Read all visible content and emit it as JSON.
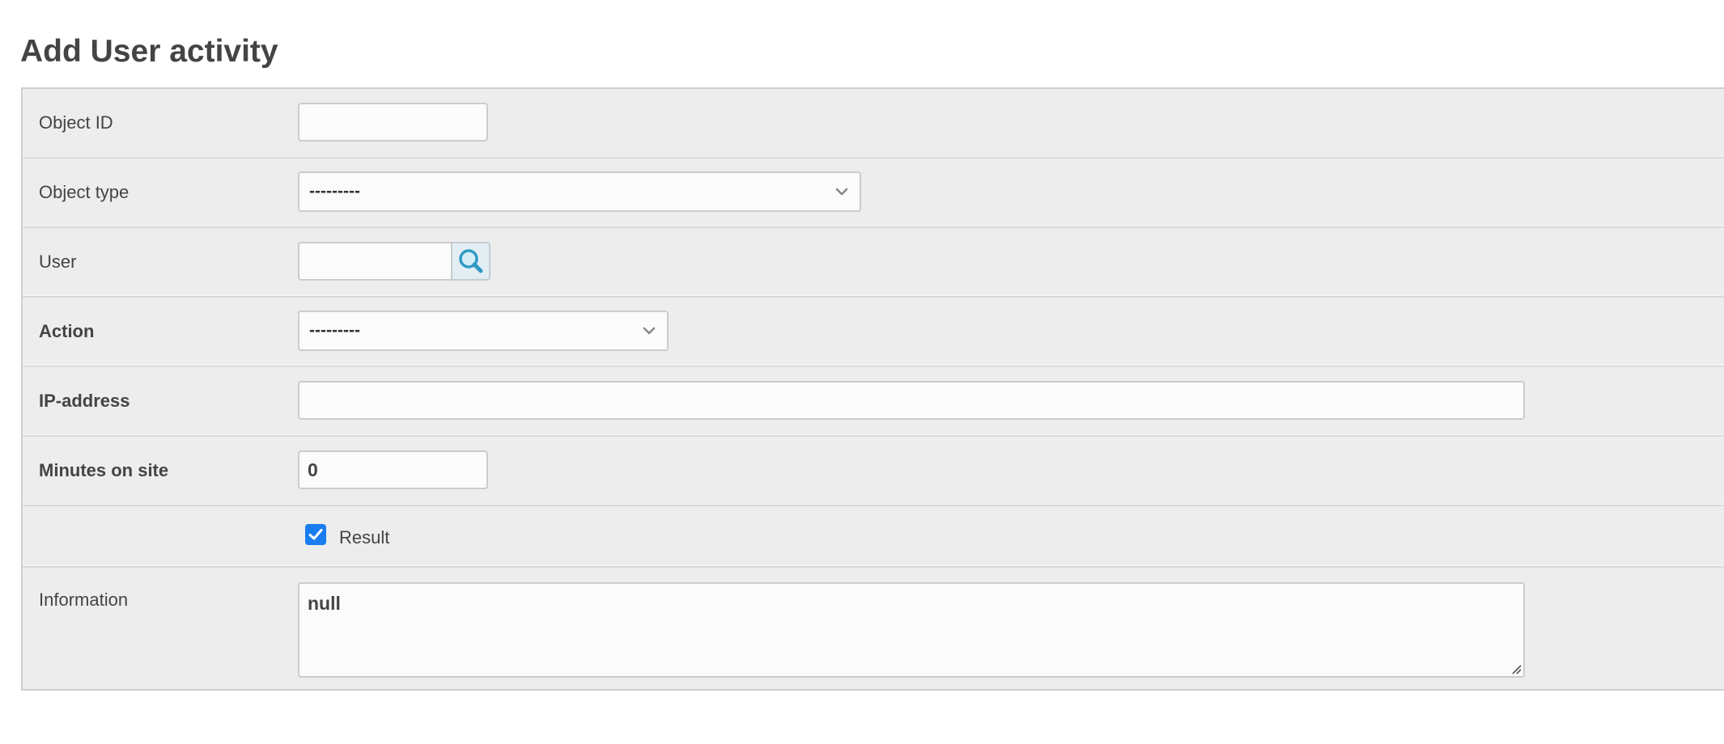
{
  "page": {
    "title": "Add User activity"
  },
  "form": {
    "object_id": {
      "label": "Object ID",
      "value": ""
    },
    "object_type": {
      "label": "Object type",
      "selected": "---------"
    },
    "user": {
      "label": "User",
      "value": "",
      "lookup_icon": "magnifier-icon"
    },
    "action": {
      "label": "Action",
      "selected": "---------"
    },
    "ip_address": {
      "label": "IP-address",
      "value": ""
    },
    "minutes_on_site": {
      "label": "Minutes on site",
      "value": "0"
    },
    "result": {
      "label": "Result",
      "checked": true
    },
    "information": {
      "label": "Information",
      "value": "null"
    }
  },
  "colors": {
    "panel_background": "#ededed",
    "checkbox_accent": "#1a7df0",
    "lookup_icon": "#2f9ac4"
  }
}
